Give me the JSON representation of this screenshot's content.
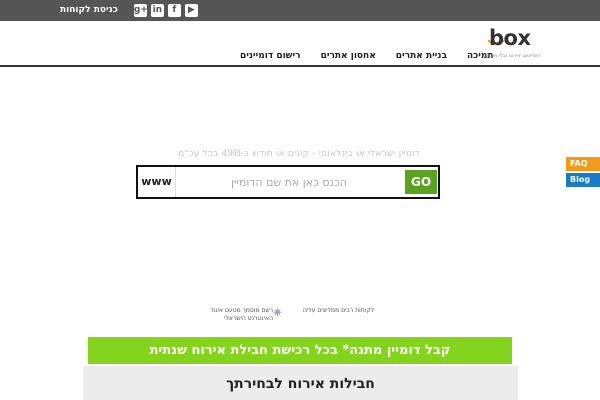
{
  "topbar": {
    "client_login": "כניסת לקוחות",
    "social": [
      {
        "icon": "googleplus-icon",
        "glyph": "g+"
      },
      {
        "icon": "linkedin-icon",
        "glyph": "in"
      },
      {
        "icon": "facebook-icon",
        "glyph": "f"
      },
      {
        "icon": "youtube-icon",
        "glyph": "▶"
      }
    ]
  },
  "logo": {
    "word": "box",
    "tagline": "דומיינים, אירוח ובלי משחק"
  },
  "nav": {
    "items": [
      "רישום דומיינים",
      "אחסון אתרים",
      "בניית אתרים",
      "תמיכה"
    ]
  },
  "search": {
    "tagline": "דומיין ישראלי או בינלאומי - קונים או חודש ב-49₪ בכל עכ\"מ",
    "prefix": "www",
    "placeholder": "הכנס כאן את שם הדומיין",
    "go_label": "GO"
  },
  "side_tabs": {
    "faq": "FAQ",
    "blog": "Blog"
  },
  "features": [
    "רשם מוסמך מטעם איגוד האינטרנט הישראלי",
    "לקוחות רבים ממליצים עלינו"
  ],
  "banner": {
    "prefix": "קבל ",
    "highlight": "דומיין מתנה*",
    "suffix": " בכל רכישת חבילת אירוח שנתית"
  },
  "bottom": {
    "title": "חבילות אירוח לבחירתך"
  },
  "colors": {
    "topbar": "#565656",
    "go_button": "#5aa322",
    "banner": "#84d41d",
    "faq": "#f39a1e",
    "blog": "#1a7ac6"
  }
}
